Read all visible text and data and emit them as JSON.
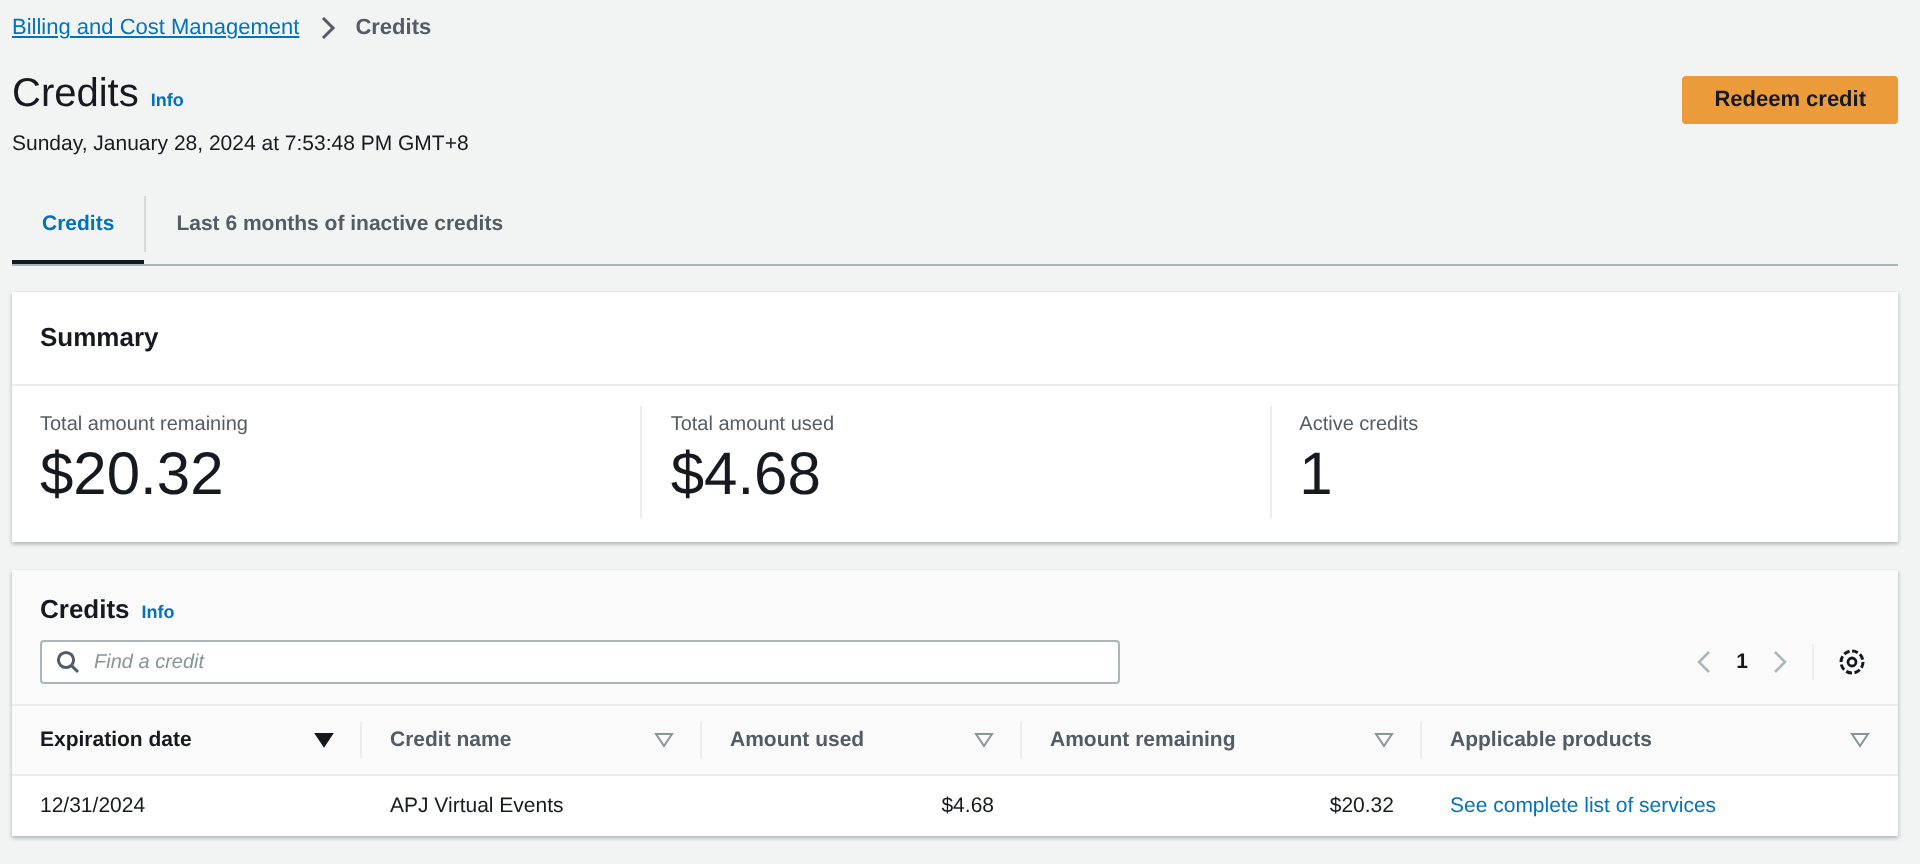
{
  "breadcrumb": [
    {
      "label": "Billing and Cost Management",
      "kind": "link"
    },
    {
      "label": "Credits",
      "kind": "current"
    }
  ],
  "header": {
    "title": "Credits",
    "info": "Info",
    "timestamp": "Sunday, January 28, 2024 at 7:53:48 PM GMT+8",
    "button": "Redeem credit"
  },
  "tabs": [
    {
      "label": "Credits",
      "selected": true
    },
    {
      "label": "Last 6 months of inactive credits",
      "selected": false
    }
  ],
  "summary": {
    "title": "Summary",
    "metrics": [
      {
        "label": "Total amount remaining",
        "value": "$20.32"
      },
      {
        "label": "Total amount used",
        "value": "$4.68"
      },
      {
        "label": "Active credits",
        "value": "1"
      }
    ]
  },
  "credits_table": {
    "title": "Credits",
    "info": "Info",
    "search": {
      "placeholder": "Find a credit"
    },
    "page": "1",
    "columns": [
      {
        "label": "Expiration date",
        "sorted": true,
        "kind": "text"
      },
      {
        "label": "Credit name",
        "sorted": false,
        "kind": "text"
      },
      {
        "label": "Amount used",
        "sorted": false,
        "kind": "amount"
      },
      {
        "label": "Amount remaining",
        "sorted": false,
        "kind": "amount"
      },
      {
        "label": "Applicable products",
        "sorted": false,
        "kind": "link"
      }
    ],
    "rows": [
      [
        "12/31/2024",
        "APJ Virtual Events",
        "$4.68",
        "$20.32",
        "See complete list of services"
      ]
    ]
  }
}
